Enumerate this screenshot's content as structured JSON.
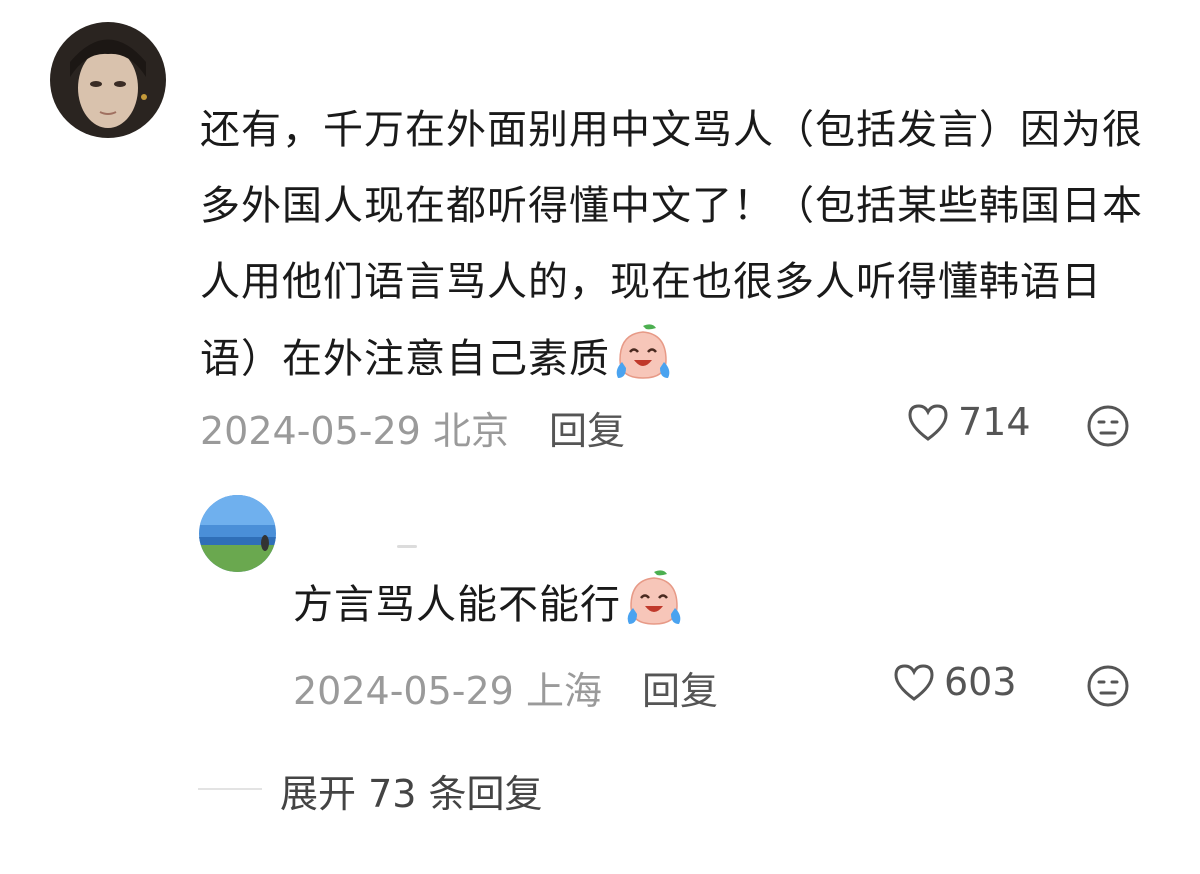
{
  "main_comment": {
    "text": "还有，千万在外面别用中文骂人（包括发言）因为很多外国人现在都听得懂中文了！（包括某些韩国日本人用他们语言骂人的，现在也很多人听得懂韩语日语）在外注意自己素质",
    "emoji": "crying-laugh-emoji",
    "date": "2024-05-29",
    "location": "北京",
    "reply_label": "回复",
    "likes": "714"
  },
  "reply_comment": {
    "text": "方言骂人能不能行",
    "emoji": "crying-laugh-emoji",
    "date": "2024-05-29",
    "location": "上海",
    "reply_label": "回复",
    "likes": "603"
  },
  "expand": {
    "label": "展开 73 条回复"
  },
  "colors": {
    "text": "#1a1a1a",
    "meta": "#9a9a9a",
    "action": "#555555"
  }
}
